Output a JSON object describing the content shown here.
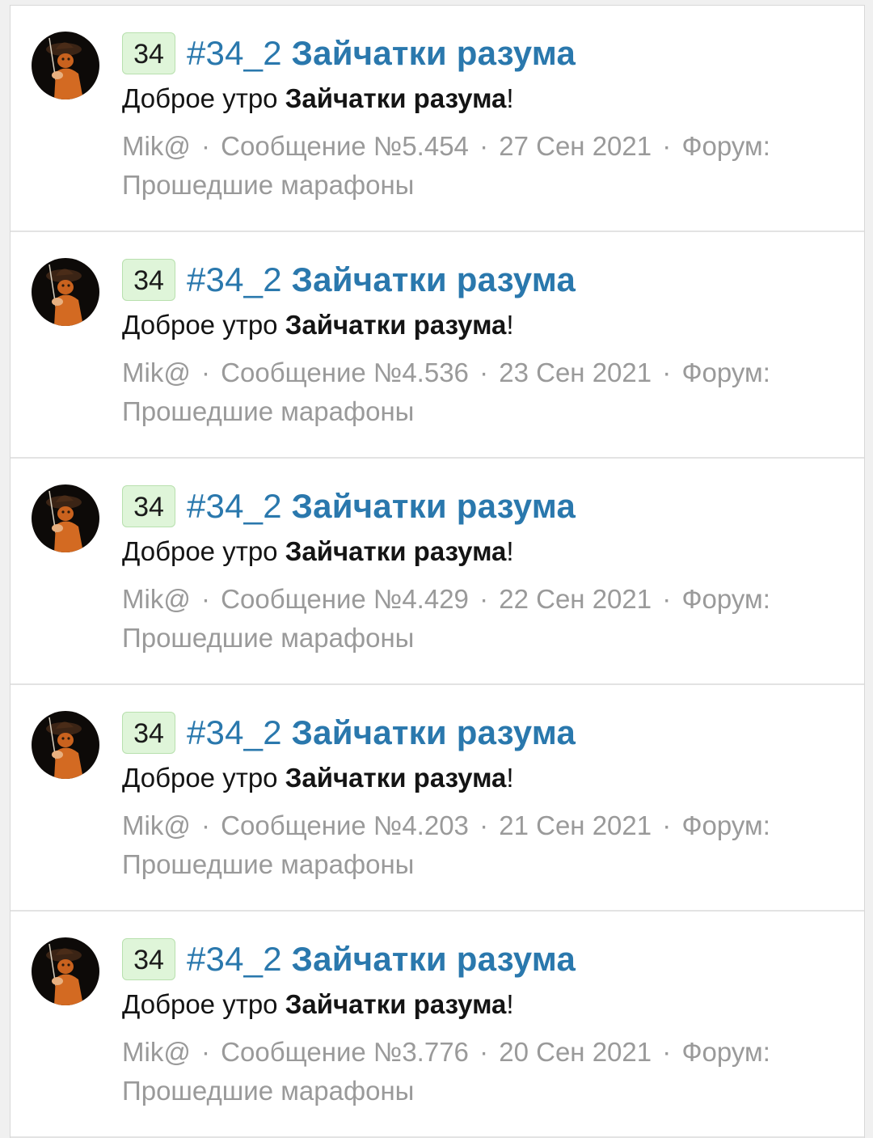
{
  "results": [
    {
      "badge": "34",
      "title_prefix": "#34_2",
      "title_main": "Зайчатки разума",
      "snippet_plain": "Доброе утро ",
      "snippet_bold": "Зайчатки разума",
      "snippet_end": "!",
      "author": "Mik@",
      "sep": "·",
      "message": "Сообщение №5.454",
      "date": "27 Сен 2021",
      "forum_label": "Форум:",
      "forum_name": "Прошедшие марафоны"
    },
    {
      "badge": "34",
      "title_prefix": "#34_2",
      "title_main": "Зайчатки разума",
      "snippet_plain": "Доброе утро ",
      "snippet_bold": "Зайчатки разума",
      "snippet_end": "!",
      "author": "Mik@",
      "sep": "·",
      "message": "Сообщение №4.536",
      "date": "23 Сен 2021",
      "forum_label": "Форум:",
      "forum_name": "Прошедшие марафоны"
    },
    {
      "badge": "34",
      "title_prefix": "#34_2",
      "title_main": "Зайчатки разума",
      "snippet_plain": "Доброе утро ",
      "snippet_bold": "Зайчатки разума",
      "snippet_end": "!",
      "author": "Mik@",
      "sep": "·",
      "message": "Сообщение №4.429",
      "date": "22 Сен 2021",
      "forum_label": "Форум:",
      "forum_name": "Прошедшие марафоны"
    },
    {
      "badge": "34",
      "title_prefix": "#34_2",
      "title_main": "Зайчатки разума",
      "snippet_plain": "Доброе утро ",
      "snippet_bold": "Зайчатки разума",
      "snippet_end": "!",
      "author": "Mik@",
      "sep": "·",
      "message": "Сообщение №4.203",
      "date": "21 Сен 2021",
      "forum_label": "Форум:",
      "forum_name": "Прошедшие марафоны"
    },
    {
      "badge": "34",
      "title_prefix": "#34_2",
      "title_main": "Зайчатки разума",
      "snippet_plain": "Доброе утро ",
      "snippet_bold": "Зайчатки разума",
      "snippet_end": "!",
      "author": "Mik@",
      "sep": "·",
      "message": "Сообщение №3.776",
      "date": "20 Сен 2021",
      "forum_label": "Форум:",
      "forum_name": "Прошедшие марафоны"
    }
  ],
  "colors": {
    "title": "#2a78ad",
    "badge_bg": "#dff5d9",
    "meta": "#9a9a9a",
    "text": "#141414"
  },
  "icons": {
    "avatar": "avatar-cat-musketeer-icon"
  }
}
